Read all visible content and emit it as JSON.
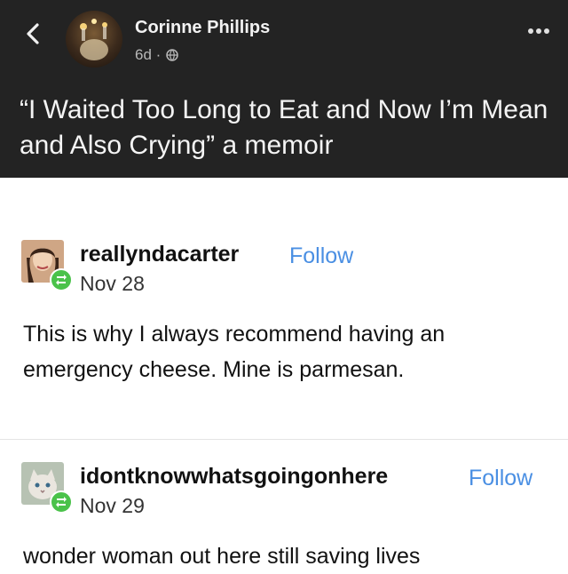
{
  "facebook": {
    "author": "Corinne Phillips",
    "time": "6d ·",
    "post_text": "“I Waited Too Long to Eat and Now I’m Mean and Also Crying” a memoir",
    "colors": {
      "background": "#232323",
      "text": "#f4f4f4"
    }
  },
  "tumblr": {
    "posts": [
      {
        "username": "reallyndacarter",
        "follow_label": "Follow",
        "date": "Nov 28",
        "text": "This is why I always recommend having an emergency cheese. Mine is parmesan."
      },
      {
        "username": "idontknowwhatsgoingonhere",
        "follow_label": "Follow",
        "date": "Nov 29",
        "text": "wonder woman out here still saving lives"
      }
    ],
    "colors": {
      "follow": "#4a8fe3",
      "reblog_badge": "#4ac24a"
    }
  },
  "icons": [
    "back-chevron-icon",
    "globe-icon",
    "more-options-icon",
    "reblog-icon"
  ]
}
